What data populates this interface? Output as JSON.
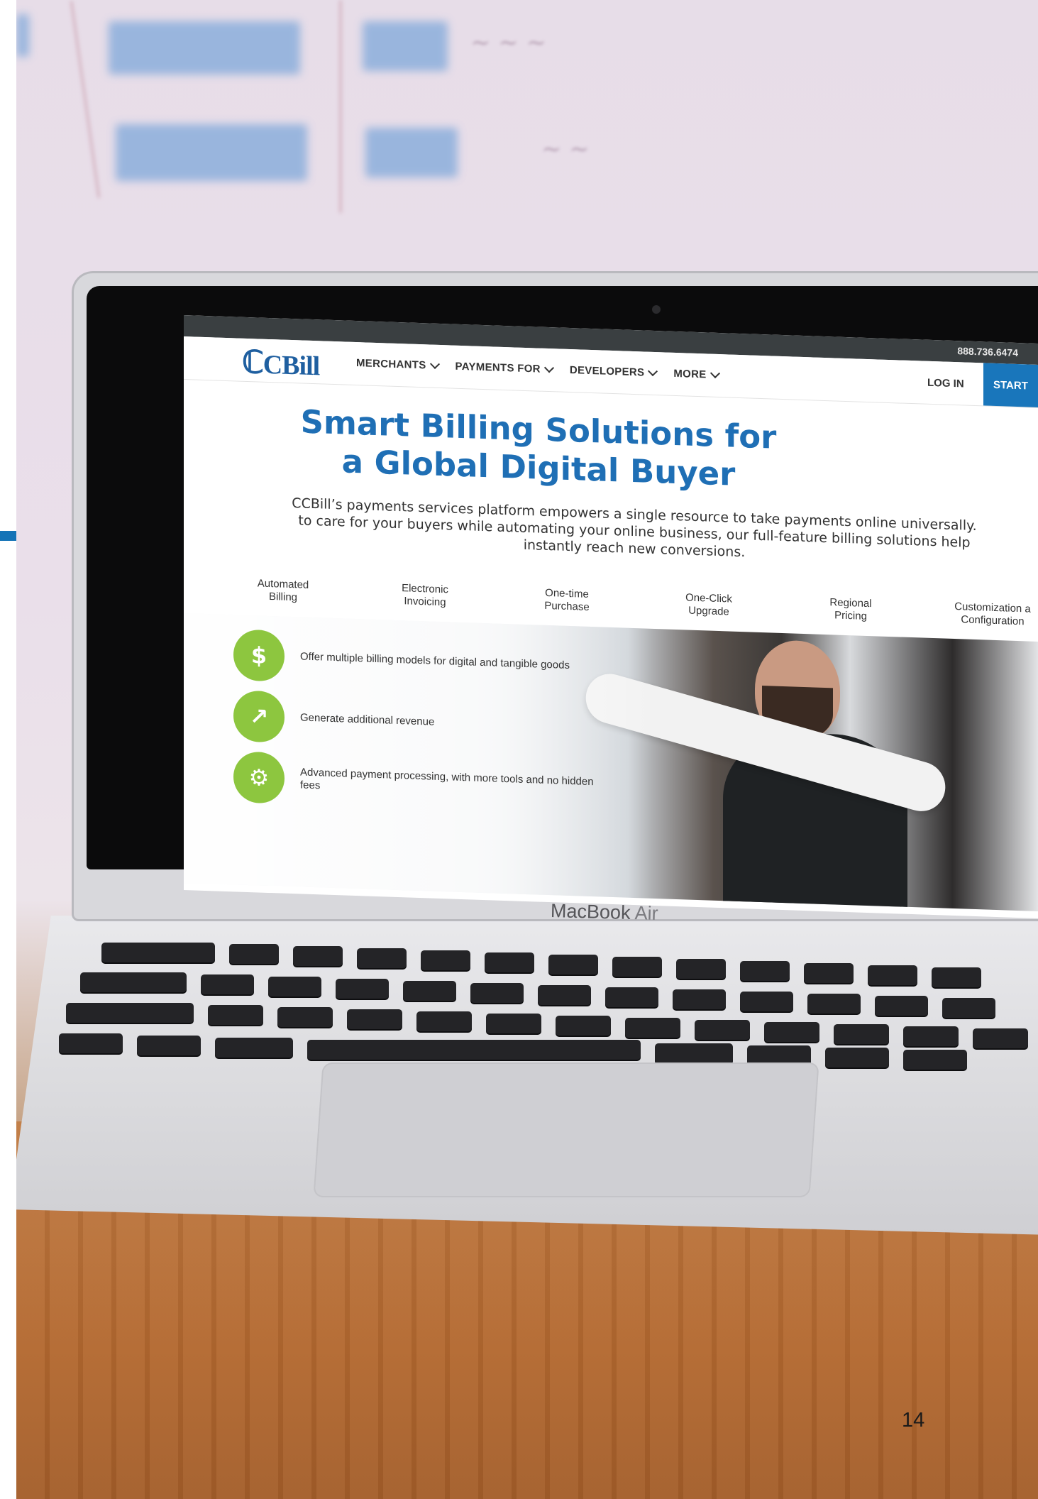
{
  "page": {
    "number": "14",
    "accent_color": "#1574b7"
  },
  "laptop": {
    "brand_label": "MacBook",
    "model_label": "Air"
  },
  "website": {
    "topbar": {
      "phone": "888.736.6474"
    },
    "nav": {
      "logo_text": "CBill",
      "items": [
        "MERCHANTS",
        "PAYMENTS FOR",
        "DEVELOPERS",
        "MORE"
      ],
      "login_label": "LOG IN",
      "start_label": "START"
    },
    "hero": {
      "title_line1": "Smart Billing Solutions for",
      "title_line2": "a Global Digital Buyer",
      "desc_line1": "CCBill’s payments services platform empowers a single resource to take payments online universally.",
      "desc_line2": "to care for your buyers while automating your online business, our full-feature billing solutions help",
      "desc_line3": "instantly reach new conversions."
    },
    "features": [
      {
        "line1": "Automated",
        "line2": "Billing"
      },
      {
        "line1": "Electronic",
        "line2": "Invoicing"
      },
      {
        "line1": "One-time",
        "line2": "Purchase"
      },
      {
        "line1": "One-Click",
        "line2": "Upgrade"
      },
      {
        "line1": "Regional",
        "line2": "Pricing"
      },
      {
        "line1": "Customization a",
        "line2": "Configuration"
      }
    ],
    "bullets": [
      {
        "icon": "price-tag-icon",
        "text": "Offer multiple billing models for digital and tangible goods"
      },
      {
        "icon": "growth-chart-icon",
        "text": "Generate additional revenue"
      },
      {
        "icon": "gears-icon",
        "text": "Advanced payment processing, with more tools and no hidden fees"
      }
    ],
    "colors": {
      "brand_blue": "#1f6fb5",
      "button_blue": "#1976bb",
      "icon_green": "#8dc63f",
      "topbar": "#3a3f41"
    }
  }
}
